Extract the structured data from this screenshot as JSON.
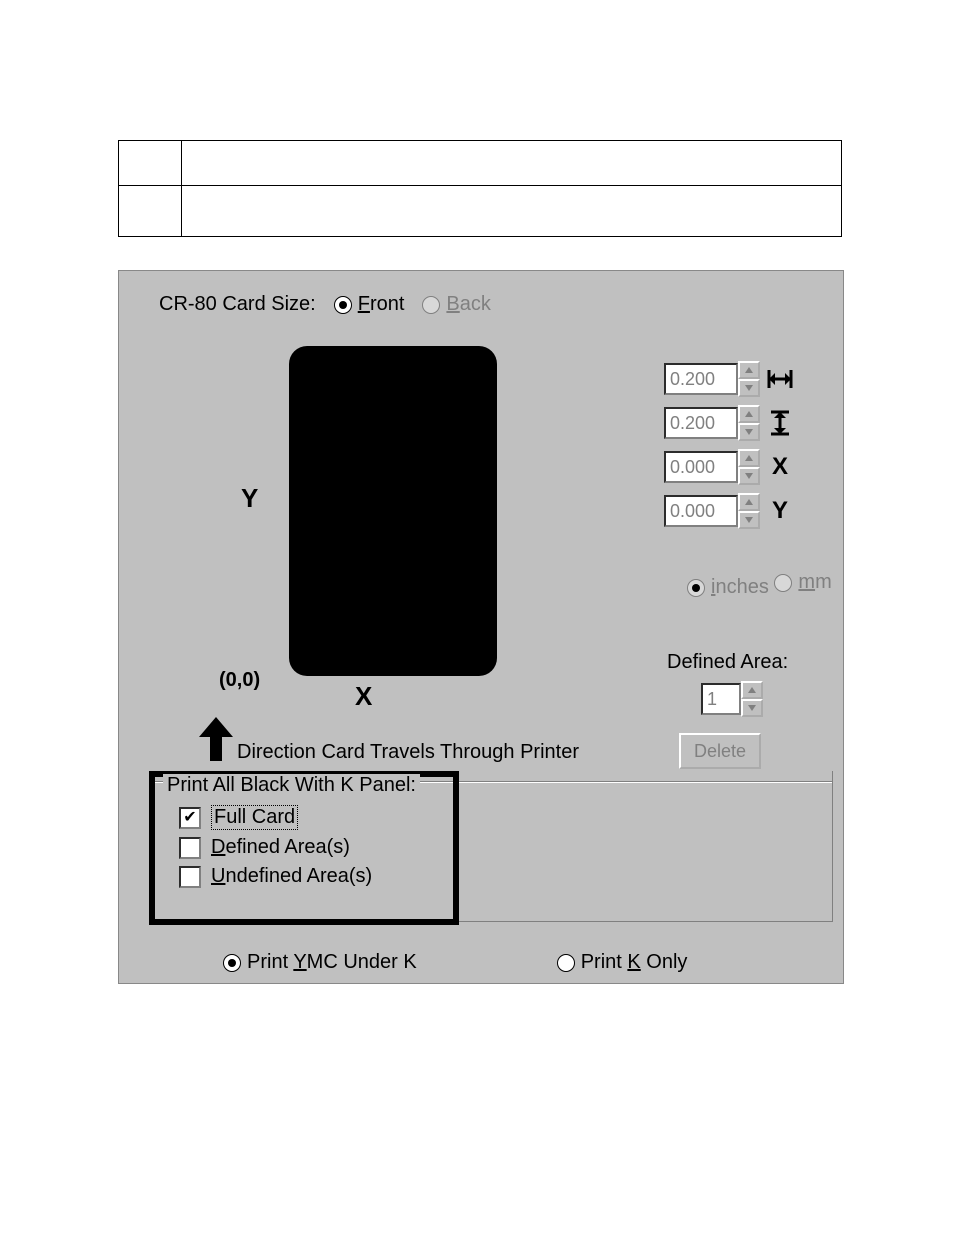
{
  "header": {
    "card_size_label": "CR-80 Card Size:",
    "front_prefix": "F",
    "front_rest": "ront",
    "back_prefix": "B",
    "back_rest": "ack"
  },
  "preview": {
    "y_axis": "Y",
    "x_axis": "X",
    "origin": "(0,0)"
  },
  "spinners": {
    "width": "0.200",
    "height": "0.200",
    "x": "0.000",
    "y": "0.000",
    "icon_x": "X",
    "icon_y": "Y"
  },
  "units": {
    "inches_prefix": "i",
    "inches_rest": "nches",
    "mm_prefix": "m",
    "mm_rest": "m"
  },
  "defined_area": {
    "label": "Defined Area:",
    "value": "1",
    "delete_label": "Delete"
  },
  "direction": {
    "text": "Direction Card Travels Through Printer"
  },
  "kpanel": {
    "group_title": "Print All Black With K Panel:",
    "full_card": "Full Card",
    "defined_prefix": "D",
    "defined_rest": "efined Area(s)",
    "undefined_prefix": "U",
    "undefined_rest": "ndefined Area(s)"
  },
  "bottom": {
    "ymc_pre": "Print ",
    "ymc_u": "Y",
    "ymc_post": "MC Under K",
    "konly_pre": "Print ",
    "konly_u": "K",
    "konly_post": " Only"
  }
}
